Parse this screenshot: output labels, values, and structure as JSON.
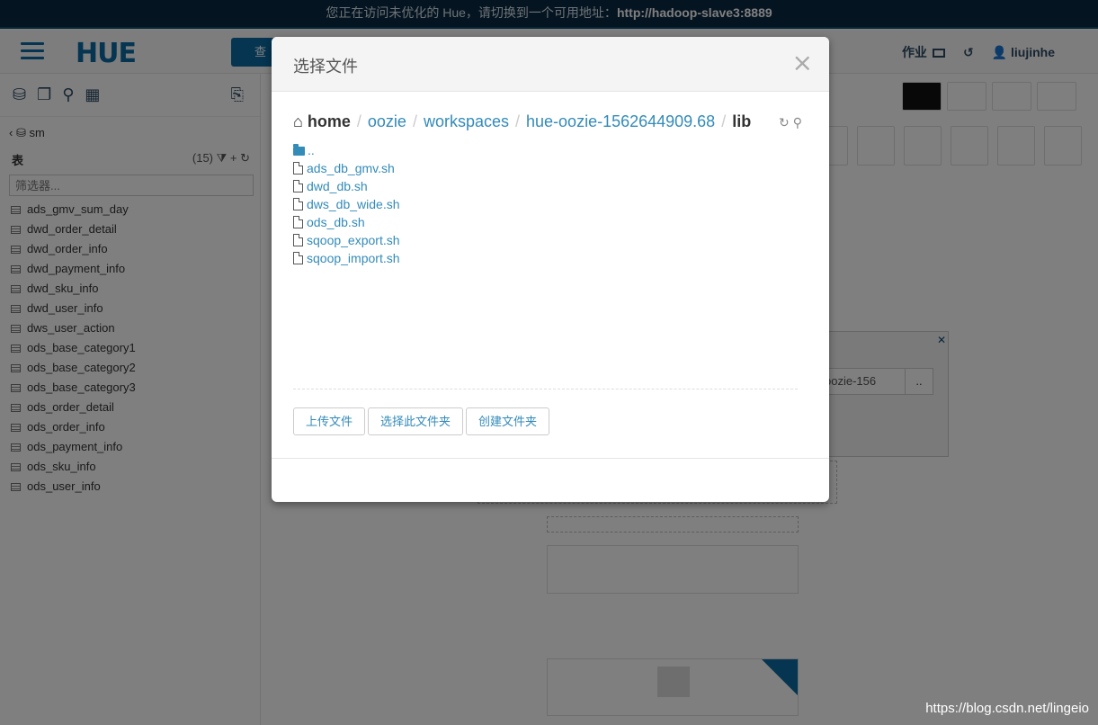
{
  "banner": {
    "text": "您正在访问未优化的 Hue，请切换到一个可用地址：",
    "address": "http://hadoop-slave3:8889"
  },
  "header": {
    "logo": "HUE",
    "query_button": "查",
    "jobs_label": "作业",
    "user": "liujinhe"
  },
  "sidebar": {
    "database": "sm",
    "tables_label": "表",
    "tables_count": "(15)",
    "filter_placeholder": "筛选器...",
    "tables": [
      "ads_gmv_sum_day",
      "dwd_order_detail",
      "dwd_order_info",
      "dwd_payment_info",
      "dwd_sku_info",
      "dwd_user_info",
      "dws_user_action",
      "ods_base_category1",
      "ods_base_category2",
      "ods_base_category3",
      "ods_order_detail",
      "ods_order_info",
      "ods_payment_info",
      "ods_sku_info",
      "ods_user_info"
    ]
  },
  "background_dialog": {
    "path_value": "oozie-156",
    "browse": ".."
  },
  "modal": {
    "title": "选择文件",
    "close": "×",
    "breadcrumb": {
      "home": "home",
      "parts": [
        "oozie",
        "workspaces",
        "hue-oozie-1562644909.68"
      ],
      "current": "lib"
    },
    "parent_folder": "..",
    "files": [
      "ads_db_gmv.sh",
      "dwd_db.sh",
      "dws_db_wide.sh",
      "ods_db.sh",
      "sqoop_export.sh",
      "sqoop_import.sh"
    ],
    "buttons": {
      "upload": "上传文件",
      "select_folder": "选择此文件夹",
      "create_folder": "创建文件夹"
    }
  },
  "watermark": "https://blog.csdn.net/lingeio"
}
